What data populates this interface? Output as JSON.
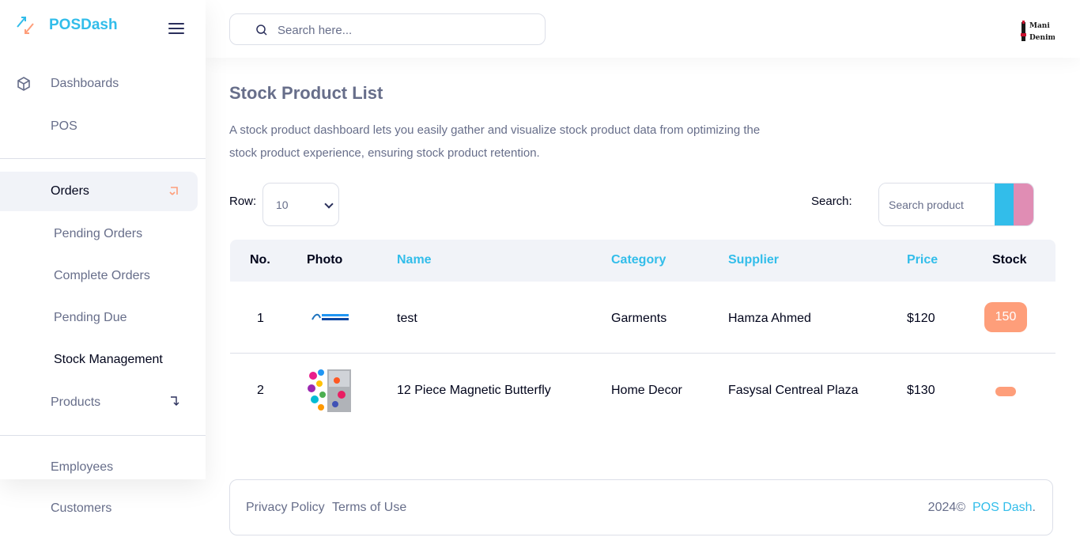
{
  "brand": {
    "name": "POSDash"
  },
  "topbar": {
    "search_placeholder": "Search here..."
  },
  "sidebar": {
    "items": [
      {
        "label": "Dashboards"
      },
      {
        "label": "POS"
      },
      {
        "label": "Orders"
      },
      {
        "label": "Products"
      },
      {
        "label": "Employees"
      },
      {
        "label": "Customers"
      }
    ],
    "orders_sub": [
      {
        "label": "Pending Orders"
      },
      {
        "label": "Complete Orders"
      },
      {
        "label": "Pending Due"
      },
      {
        "label": "Stock Management"
      }
    ]
  },
  "page": {
    "title": "Stock Product List",
    "description": "A stock product dashboard lets you easily gather and visualize stock product data from optimizing the stock product experience, ensuring stock product retention."
  },
  "controls": {
    "row_label": "Row:",
    "row_value": "10",
    "search_label": "Search:",
    "search_placeholder": "Search product"
  },
  "table": {
    "headers": [
      "No.",
      "Photo",
      "Name",
      "Category",
      "Supplier",
      "Price",
      "Stock"
    ],
    "rows": [
      {
        "no": "1",
        "name": "test",
        "category": "Garments",
        "supplier": "Hamza Ahmed",
        "price": "$120",
        "stock": "150"
      },
      {
        "no": "2",
        "name": "12 Piece Magnetic Butterfly",
        "category": "Home Decor",
        "supplier": "Fasysal Centreal Plaza",
        "price": "$130",
        "stock": ""
      }
    ]
  },
  "footer": {
    "privacy": "Privacy Policy",
    "terms": "Terms of Use",
    "copyright": "2024©",
    "brand_link": "POS Dash",
    "period": "."
  },
  "colors": {
    "accent": "#32bdea",
    "stock_badge": "#fe9e7a",
    "reset_button": "#e08db4",
    "sidebar_active": "#f1f3f8"
  }
}
